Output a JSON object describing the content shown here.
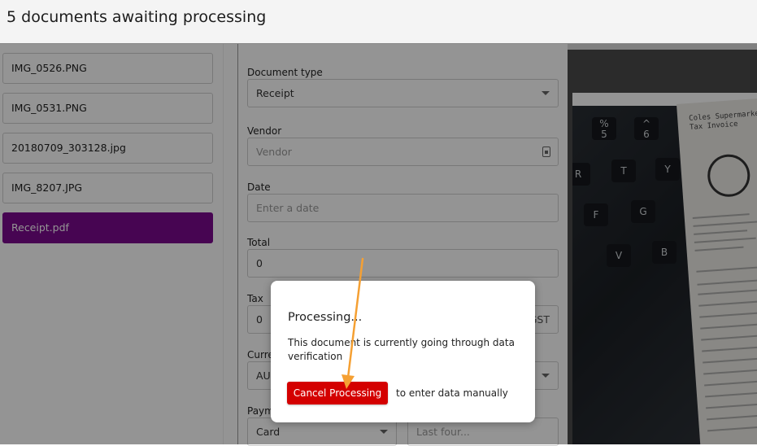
{
  "header": {
    "title": "5 documents awaiting processing"
  },
  "files": [
    {
      "name": "IMG_0526.PNG",
      "selected": false
    },
    {
      "name": "IMG_0531.PNG",
      "selected": false
    },
    {
      "name": "20180709_303128.jpg",
      "selected": false
    },
    {
      "name": "IMG_8207.JPG",
      "selected": false
    },
    {
      "name": "Receipt.pdf",
      "selected": true
    }
  ],
  "form": {
    "document_type": {
      "label": "Document type",
      "value": "Receipt"
    },
    "vendor": {
      "label": "Vendor",
      "placeholder": "Vendor"
    },
    "date": {
      "label": "Date",
      "placeholder": "Enter a date"
    },
    "total": {
      "label": "Total",
      "value": "0"
    },
    "tax": {
      "label": "Tax",
      "value": "0",
      "suffix": "GST"
    },
    "currency": {
      "label": "Curre",
      "value": "AUI"
    },
    "payment": {
      "label": "Paym",
      "method": "Card",
      "last_four_placeholder": "Last four..."
    }
  },
  "preview": {
    "keys": [
      "%\n5",
      "^\n6",
      "R",
      "T",
      "Y",
      "F",
      "G",
      "V",
      "B"
    ],
    "receipt_header": "Coles Supermarkets\nTax Invoice"
  },
  "modal": {
    "title": "Processing...",
    "body": "This document is currently going through data verification",
    "cancel_label": "Cancel Processing",
    "hint": "to enter data manually"
  },
  "colors": {
    "selected_item": "#7b0a8e",
    "cancel_button": "#d40000",
    "annotation_arrow": "#f5a033"
  },
  "icons": {
    "vendor_field": "contact-card-icon",
    "select_caret": "caret-down-icon"
  }
}
